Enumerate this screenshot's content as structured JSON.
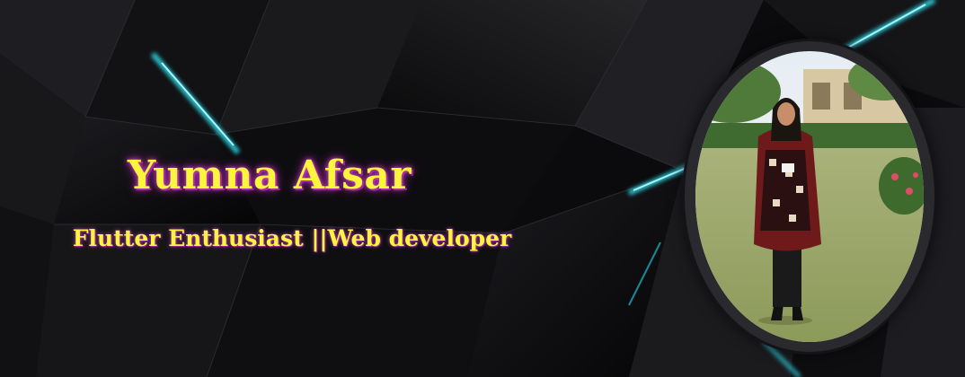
{
  "profile": {
    "name": "Yumna Afsar",
    "tagline": "Flutter Enthusiast ||Web developer"
  },
  "colors": {
    "background": "#0b0b0d",
    "accent": "#2fd6e6",
    "text": "#fbf53c",
    "glow": "#c23dbd"
  },
  "photo": {
    "icon": "portrait-photo"
  }
}
